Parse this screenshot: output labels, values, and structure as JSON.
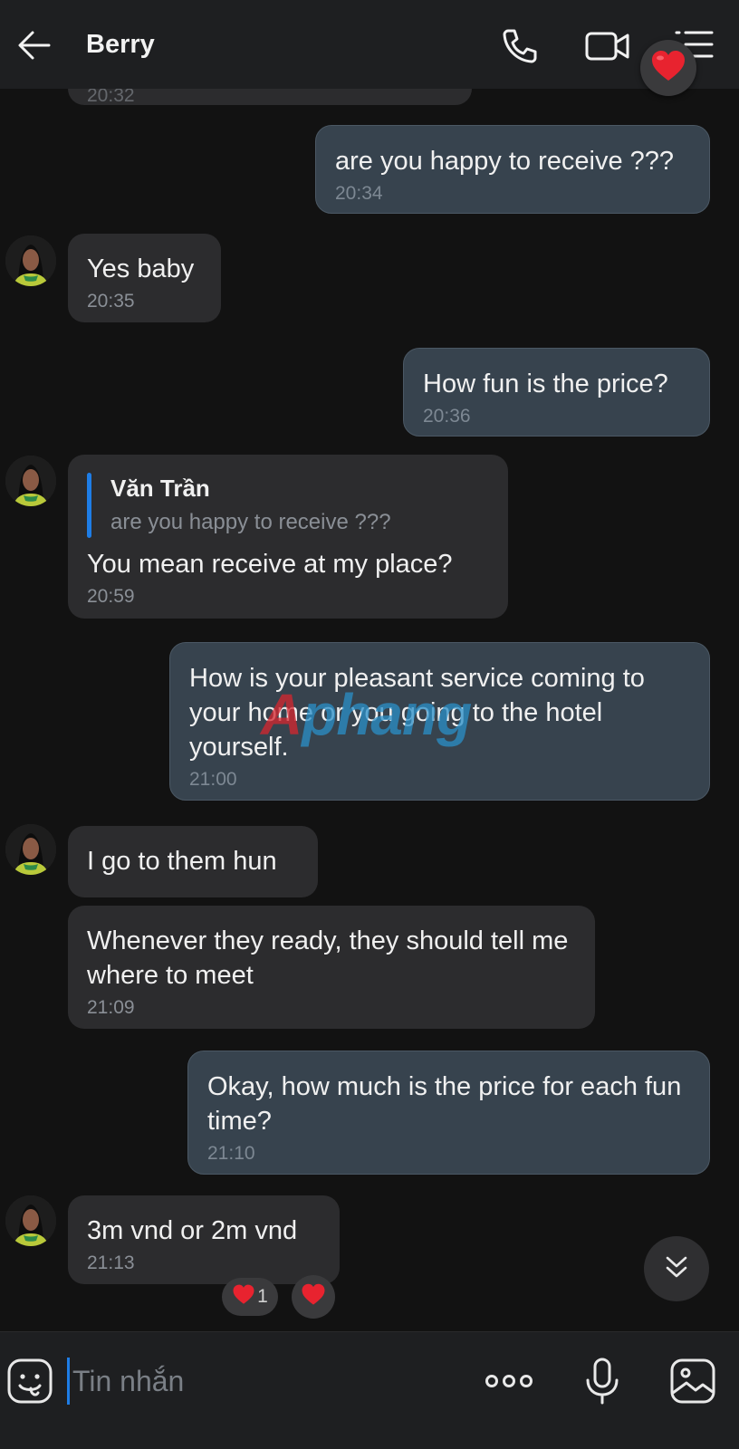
{
  "header": {
    "contact_name": "Berry"
  },
  "reactions_popup": {
    "emoji": "heart"
  },
  "messages": [
    {
      "direction": "in",
      "text": "",
      "time": "20:32"
    },
    {
      "direction": "out",
      "text": "are you happy to receive ???",
      "time": "20:34"
    },
    {
      "direction": "in",
      "text": "Yes baby",
      "time": "20:35"
    },
    {
      "direction": "out",
      "text": "How fun is the price?",
      "time": "20:36"
    },
    {
      "direction": "in",
      "reply_to_name": "Văn Trần",
      "reply_to_text": "are you happy to receive ???",
      "text": "You mean receive at my place?",
      "time": "20:59"
    },
    {
      "direction": "out",
      "text": "How is your pleasant service coming to your home or you going to the hotel yourself.",
      "time": "21:00"
    },
    {
      "direction": "in",
      "text": "I go to them hun",
      "time": ""
    },
    {
      "direction": "in",
      "text": "Whenever they ready, they should tell me where to meet",
      "time": "21:09"
    },
    {
      "direction": "out",
      "text": "Okay, how much is the price for each fun time?",
      "time": "21:10"
    },
    {
      "direction": "in",
      "text": "3m vnd or 2m vnd",
      "time": "21:13"
    }
  ],
  "last_message_reactions": {
    "heart_count": "1"
  },
  "watermark": {
    "text_red": "A",
    "text_blue": "phang"
  },
  "composer": {
    "placeholder": "Tin nhắn"
  },
  "colors": {
    "incoming_bubble": "#2c2c2e",
    "outgoing_bubble": "#37434e",
    "accent": "#1e7de6",
    "background": "#121212"
  }
}
